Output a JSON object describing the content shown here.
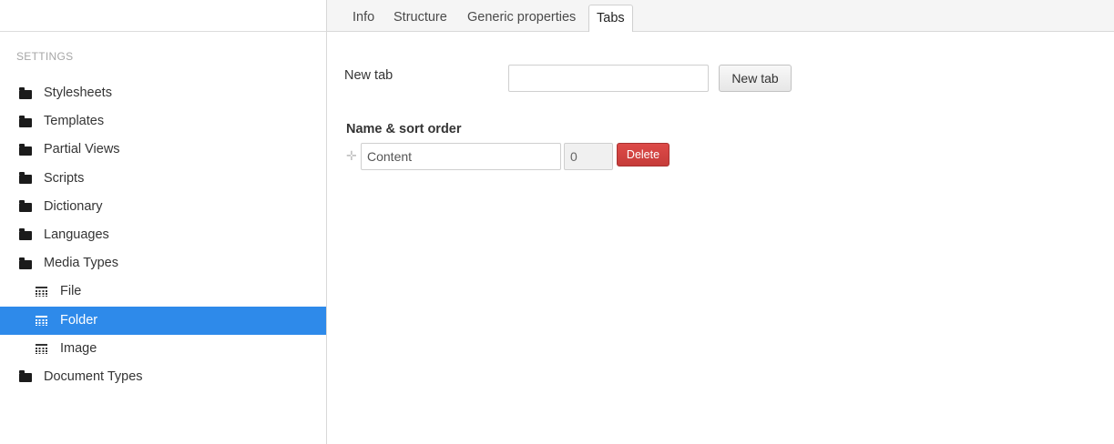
{
  "sidebar": {
    "section_title": "SETTINGS",
    "items": [
      {
        "label": "Stylesheets",
        "icon": "folder-icon",
        "level": 0
      },
      {
        "label": "Templates",
        "icon": "folder-icon",
        "level": 0
      },
      {
        "label": "Partial Views",
        "icon": "folder-icon",
        "level": 0
      },
      {
        "label": "Scripts",
        "icon": "folder-icon",
        "level": 0
      },
      {
        "label": "Dictionary",
        "icon": "folder-icon",
        "level": 0
      },
      {
        "label": "Languages",
        "icon": "folder-icon",
        "level": 0
      },
      {
        "label": "Media Types",
        "icon": "folder-icon",
        "level": 0
      },
      {
        "label": "File",
        "icon": "grid-icon",
        "level": 1
      },
      {
        "label": "Folder",
        "icon": "grid-icon",
        "level": 1,
        "selected": true
      },
      {
        "label": "Image",
        "icon": "grid-icon",
        "level": 1
      },
      {
        "label": "Document Types",
        "icon": "folder-icon",
        "level": 0
      }
    ]
  },
  "tabs": [
    {
      "label": "Info"
    },
    {
      "label": "Structure"
    },
    {
      "label": "Generic properties"
    },
    {
      "label": "Tabs",
      "active": true
    }
  ],
  "new_tab": {
    "label": "New tab",
    "input_value": "",
    "button_label": "New tab"
  },
  "tab_list": {
    "heading": "Name & sort order",
    "rows": [
      {
        "name": "Content",
        "sort_order": "0",
        "delete_label": "Delete"
      }
    ]
  },
  "colors": {
    "selected": "#2e8aea",
    "danger": "#d4403e"
  }
}
